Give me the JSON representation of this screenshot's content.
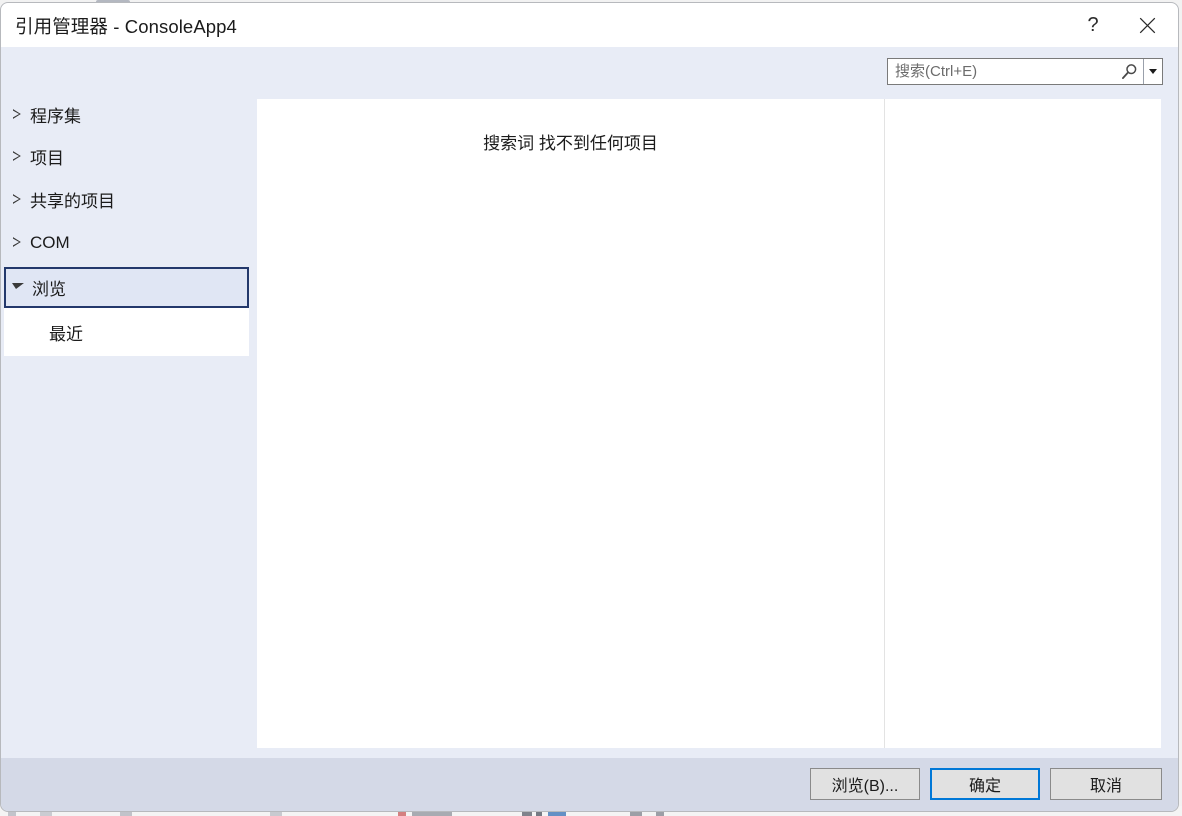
{
  "window": {
    "title": "引用管理器 - ConsoleApp4",
    "help_label": "?",
    "close_label": "✕"
  },
  "search": {
    "placeholder": "搜索(Ctrl+E)",
    "value": "",
    "icon": "search-icon",
    "dropdown_icon": "chevron-down-icon"
  },
  "sidebar": {
    "items": [
      {
        "label": "程序集",
        "expanded": false,
        "selected": false
      },
      {
        "label": "项目",
        "expanded": false,
        "selected": false
      },
      {
        "label": "共享的项目",
        "expanded": false,
        "selected": false
      },
      {
        "label": "COM",
        "expanded": false,
        "selected": false
      },
      {
        "label": "浏览",
        "expanded": true,
        "selected": true
      }
    ],
    "children": [
      {
        "label": "最近",
        "parent": "浏览",
        "selected": false
      }
    ]
  },
  "main": {
    "empty_message": "搜索词  找不到任何项目"
  },
  "footer": {
    "browse_label": "浏览(B)...",
    "ok_label": "确定",
    "cancel_label": "取消"
  },
  "colors": {
    "dialog_background": "#e8ecf6",
    "footer_background": "#d4d9e7",
    "content_background": "#ffffff",
    "selection_border": "#23386b",
    "default_button_border": "#0078d7",
    "button_face": "#e1e1e1",
    "text": "#1b1b1b"
  }
}
